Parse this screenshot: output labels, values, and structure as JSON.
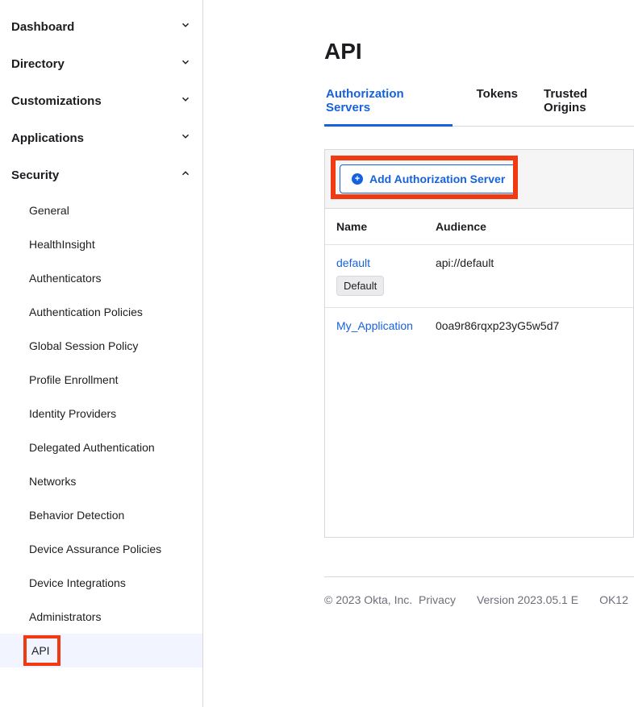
{
  "sidebar": {
    "items": [
      {
        "label": "Dashboard",
        "expanded": false
      },
      {
        "label": "Directory",
        "expanded": false
      },
      {
        "label": "Customizations",
        "expanded": false
      },
      {
        "label": "Applications",
        "expanded": false
      },
      {
        "label": "Security",
        "expanded": true,
        "children": [
          {
            "label": "General"
          },
          {
            "label": "HealthInsight"
          },
          {
            "label": "Authenticators"
          },
          {
            "label": "Authentication Policies"
          },
          {
            "label": "Global Session Policy"
          },
          {
            "label": "Profile Enrollment"
          },
          {
            "label": "Identity Providers"
          },
          {
            "label": "Delegated Authentication"
          },
          {
            "label": "Networks"
          },
          {
            "label": "Behavior Detection"
          },
          {
            "label": "Device Assurance Policies"
          },
          {
            "label": "Device Integrations"
          },
          {
            "label": "Administrators"
          },
          {
            "label": "API",
            "active": true,
            "highlighted": true
          }
        ]
      }
    ]
  },
  "page": {
    "title": "API"
  },
  "tabs": [
    {
      "label": "Authorization Servers",
      "active": true
    },
    {
      "label": "Tokens"
    },
    {
      "label": "Trusted Origins"
    }
  ],
  "toolbar": {
    "add_button": "Add Authorization Server"
  },
  "table": {
    "columns": [
      "Name",
      "Audience"
    ],
    "rows": [
      {
        "name": "default",
        "audience": "api://default",
        "badge": "Default"
      },
      {
        "name": "My_Application",
        "audience": "0oa9r86rqxp23yG5w5d7"
      }
    ]
  },
  "footer": {
    "copyright": "© 2023 Okta, Inc.",
    "privacy": "Privacy",
    "version": "Version 2023.05.1 E",
    "cell": "OK12"
  }
}
